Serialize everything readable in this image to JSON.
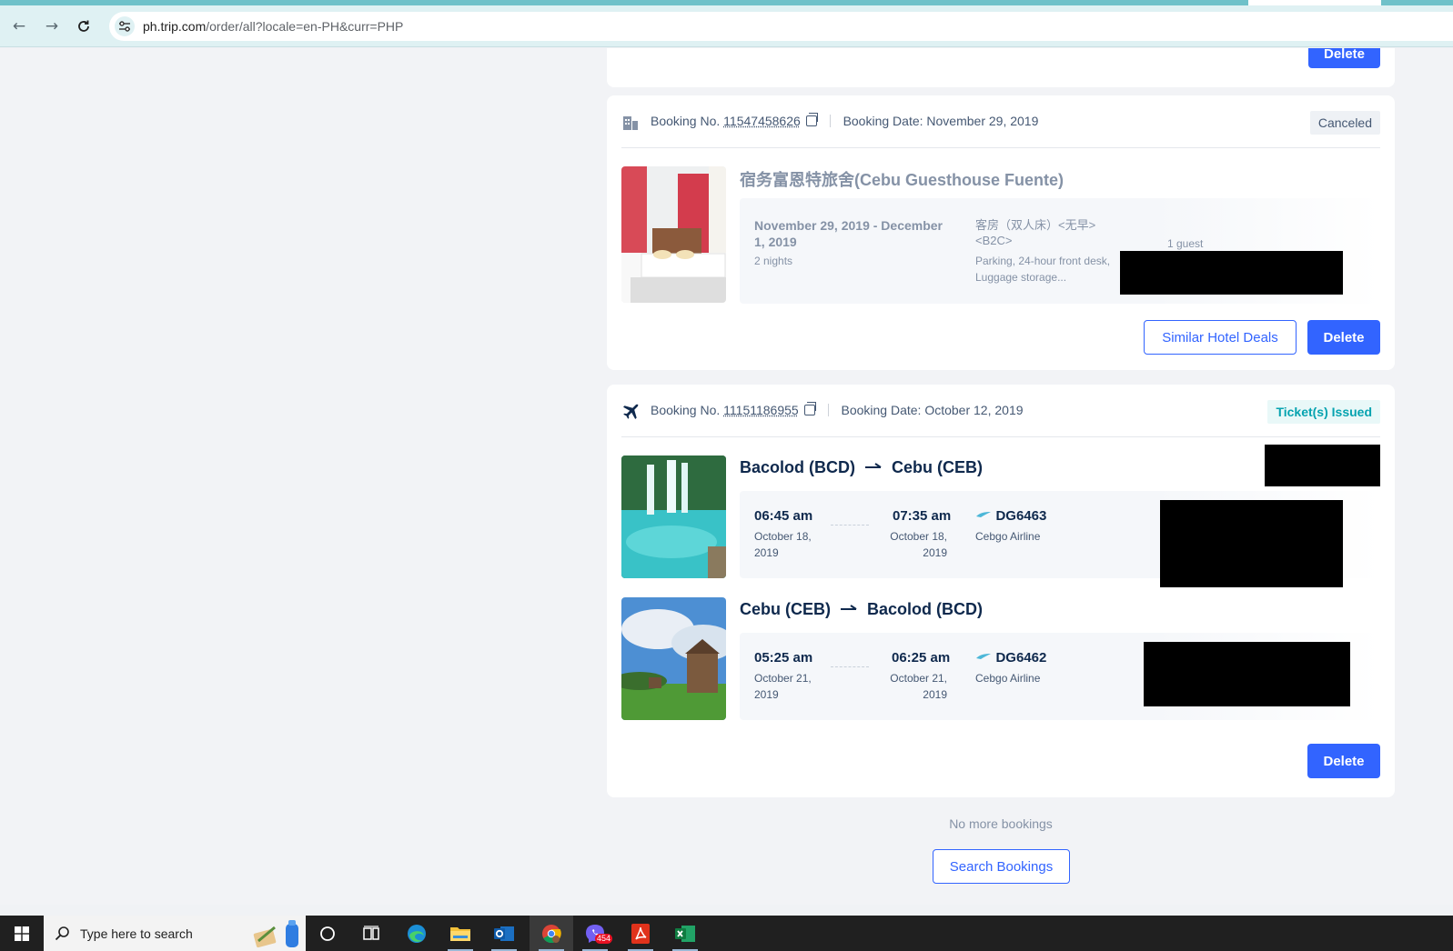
{
  "browser": {
    "url_host": "ph.trip.com",
    "url_path": "/order/all?locale=en-PH&curr=PHP"
  },
  "top_card": {
    "delete_label": "Delete"
  },
  "hotel_booking": {
    "booking_no_label": "Booking No.",
    "booking_no": "11547458626",
    "booking_date_label": "Booking Date:",
    "booking_date": "November 29, 2019",
    "status": "Canceled",
    "hotel_name": "宿务富恩特旅舍(Cebu Guesthouse Fuente)",
    "stay_dates": "November 29, 2019 - December 1, 2019",
    "nights": "2 nights",
    "room_type": "客房（双人床）<无早><B2C>",
    "amenities": "Parking, 24-hour front desk, Luggage storage...",
    "guests": "1 guest",
    "similar_label": "Similar Hotel Deals",
    "delete_label": "Delete"
  },
  "flight_booking": {
    "booking_no_label": "Booking No.",
    "booking_no": "11151186955",
    "booking_date_label": "Booking Date:",
    "booking_date": "October 12, 2019",
    "status": "Ticket(s) Issued",
    "legs": [
      {
        "route_from": "Bacolod (BCD)",
        "route_to": "Cebu (CEB)",
        "dep_time": "06:45 am",
        "dep_date": "October 18, 2019",
        "arr_time": "07:35 am",
        "arr_date": "October 18, 2019",
        "flight_no": "DG6463",
        "airline": "Cebgo Airline"
      },
      {
        "route_from": "Cebu (CEB)",
        "route_to": "Bacolod (BCD)",
        "dep_time": "05:25 am",
        "dep_date": "October 21, 2019",
        "arr_time": "06:25 am",
        "arr_date": "October 21, 2019",
        "flight_no": "DG6462",
        "airline": "Cebgo Airline"
      }
    ],
    "delete_label": "Delete"
  },
  "footer": {
    "no_more": "No more bookings",
    "search_label": "Search Bookings"
  },
  "taskbar": {
    "search_placeholder": "Type here to search",
    "viber_badge": "454"
  }
}
